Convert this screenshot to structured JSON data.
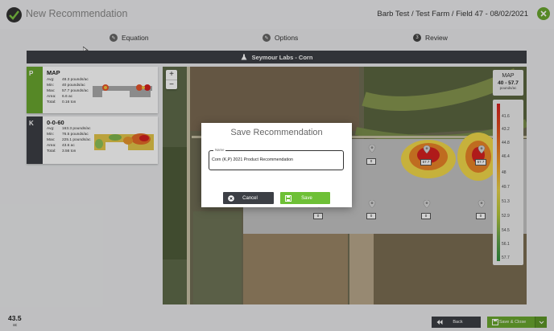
{
  "header": {
    "app_title": "New Recommendation",
    "breadcrumb": "Barb Test / Test Farm / Field 47 - 08/02/2021"
  },
  "steps": [
    {
      "label": "Equation",
      "icon": "edit-icon"
    },
    {
      "label": "Options",
      "icon": "edit-icon"
    },
    {
      "label": "Review",
      "number": "3"
    }
  ],
  "banner": {
    "label": "Seymour Labs - Corn",
    "icon": "flask-icon"
  },
  "layers": [
    {
      "tab": "P",
      "name": "MAP",
      "tab_color": "#6aa62f",
      "stats": [
        {
          "label": "Avg:",
          "value": "48.3 pounds/ac"
        },
        {
          "label": "Min:",
          "value": "40 pounds/ac"
        },
        {
          "label": "Max:",
          "value": "57.7 pounds/ac"
        },
        {
          "label": "Area:",
          "value": "6.6 ac"
        },
        {
          "label": "Total:",
          "value": "0.16 ton"
        }
      ]
    },
    {
      "tab": "K",
      "name": "0-0-60",
      "tab_color": "#3c3f45",
      "stats": [
        {
          "label": "Avg:",
          "value": "163.3 pounds/ac"
        },
        {
          "label": "Min:",
          "value": "76.5 pounds/ac"
        },
        {
          "label": "Max:",
          "value": "225.1 pounds/ac"
        },
        {
          "label": "Area:",
          "value": "43.6 ac"
        },
        {
          "label": "Total:",
          "value": "3.56 ton"
        }
      ]
    }
  ],
  "map": {
    "zoom_in": "+",
    "zoom_out": "−",
    "pins": [
      "0",
      "57.7",
      "57.7",
      "0",
      "0",
      "0",
      "0"
    ]
  },
  "legend": {
    "title": "MAP",
    "range": "40 - 57.7",
    "unit": "pounds/ac",
    "labels": [
      "41.6",
      "43.2",
      "44.8",
      "46.4",
      "48",
      "49.7",
      "51.3",
      "52.9",
      "54.5",
      "56.1",
      "57.7"
    ]
  },
  "dialog": {
    "title": "Save Recommendation",
    "field_label": "Name",
    "field_value": "Corn (K,P) 2021 Product Recommendation",
    "cancel_label": "Cancel",
    "save_label": "Save"
  },
  "footer": {
    "acres": "43.5",
    "acres_unit": "ac",
    "back_label": "Back",
    "save_close_label": "Save & Close"
  },
  "colors": {
    "accent": "#6ec036",
    "dark": "#3c3f45"
  }
}
